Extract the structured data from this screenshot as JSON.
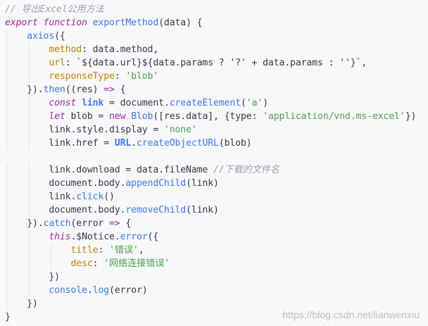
{
  "code": {
    "lines": [
      [
        {
          "t": "// 导出Excel公用方法",
          "c": "c"
        }
      ],
      [
        {
          "t": "export ",
          "c": "k"
        },
        {
          "t": "function ",
          "c": "k"
        },
        {
          "t": "exportMethod",
          "c": "f"
        },
        {
          "t": "(data) {",
          "c": "p"
        }
      ],
      [
        {
          "t": "    axios",
          "c": "f"
        },
        {
          "t": "({",
          "c": "p"
        }
      ],
      [
        {
          "t": "        method",
          "c": "prop"
        },
        {
          "t": ": data.method,",
          "c": "p"
        }
      ],
      [
        {
          "t": "        url",
          "c": "prop"
        },
        {
          "t": ": `${data.url}${data.params ? '?' + data.params : ''}`,",
          "c": "p"
        }
      ],
      [
        {
          "t": "        responseType",
          "c": "prop"
        },
        {
          "t": ": ",
          "c": "p"
        },
        {
          "t": "'blob'",
          "c": "s"
        }
      ],
      [
        {
          "t": "    }).",
          "c": "p"
        },
        {
          "t": "then",
          "c": "f"
        },
        {
          "t": "((res) ",
          "c": "p"
        },
        {
          "t": "=> ",
          "c": "kn"
        },
        {
          "t": "{",
          "c": "p"
        }
      ],
      [
        {
          "t": "        const ",
          "c": "k"
        },
        {
          "t": "link",
          "c": "kb"
        },
        {
          "t": " = document.",
          "c": "p"
        },
        {
          "t": "createElement",
          "c": "f"
        },
        {
          "t": "(",
          "c": "p"
        },
        {
          "t": "'a'",
          "c": "s"
        },
        {
          "t": ")",
          "c": "p"
        }
      ],
      [
        {
          "t": "        let ",
          "c": "k"
        },
        {
          "t": "blob = ",
          "c": "p"
        },
        {
          "t": "new ",
          "c": "kn"
        },
        {
          "t": "Blob",
          "c": "f"
        },
        {
          "t": "([res.data], {type: ",
          "c": "p"
        },
        {
          "t": "'application/vnd.ms-excel'",
          "c": "s"
        },
        {
          "t": "})",
          "c": "p"
        }
      ],
      [
        {
          "t": "        link.style.display = ",
          "c": "p"
        },
        {
          "t": "'none'",
          "c": "s"
        }
      ],
      [
        {
          "t": "        link.href = ",
          "c": "p"
        },
        {
          "t": "URL",
          "c": "kb"
        },
        {
          "t": ".",
          "c": "p"
        },
        {
          "t": "createObjectURL",
          "c": "f"
        },
        {
          "t": "(blob)",
          "c": "p"
        }
      ],
      [
        {
          "t": "",
          "c": "p"
        }
      ],
      [
        {
          "t": "        link.download = data.fileName ",
          "c": "p"
        },
        {
          "t": "//下载的文件名",
          "c": "c"
        }
      ],
      [
        {
          "t": "        document.body.",
          "c": "p"
        },
        {
          "t": "appendChild",
          "c": "f"
        },
        {
          "t": "(link)",
          "c": "p"
        }
      ],
      [
        {
          "t": "        link.",
          "c": "p"
        },
        {
          "t": "click",
          "c": "f"
        },
        {
          "t": "()",
          "c": "p"
        }
      ],
      [
        {
          "t": "        document.body.",
          "c": "p"
        },
        {
          "t": "removeChild",
          "c": "f"
        },
        {
          "t": "(link)",
          "c": "p"
        }
      ],
      [
        {
          "t": "    }).",
          "c": "p"
        },
        {
          "t": "catch",
          "c": "f"
        },
        {
          "t": "(error ",
          "c": "p"
        },
        {
          "t": "=> ",
          "c": "kn"
        },
        {
          "t": "{",
          "c": "p"
        }
      ],
      [
        {
          "t": "        this",
          "c": "k"
        },
        {
          "t": ".$Notice.",
          "c": "p"
        },
        {
          "t": "error",
          "c": "f"
        },
        {
          "t": "({",
          "c": "p"
        }
      ],
      [
        {
          "t": "            title",
          "c": "prop"
        },
        {
          "t": ": ",
          "c": "p"
        },
        {
          "t": "'错误'",
          "c": "s"
        },
        {
          "t": ",",
          "c": "p"
        }
      ],
      [
        {
          "t": "            desc",
          "c": "prop"
        },
        {
          "t": ": ",
          "c": "p"
        },
        {
          "t": "'网络连接错误'",
          "c": "s"
        }
      ],
      [
        {
          "t": "        })",
          "c": "p"
        }
      ],
      [
        {
          "t": "        console",
          "c": "f"
        },
        {
          "t": ".",
          "c": "p"
        },
        {
          "t": "log",
          "c": "f"
        },
        {
          "t": "(error)",
          "c": "p"
        }
      ],
      [
        {
          "t": "    })",
          "c": "p"
        }
      ],
      [
        {
          "t": "}",
          "c": "p"
        }
      ]
    ]
  },
  "watermark": "https://blog.csdn.net/lianwenxiu"
}
